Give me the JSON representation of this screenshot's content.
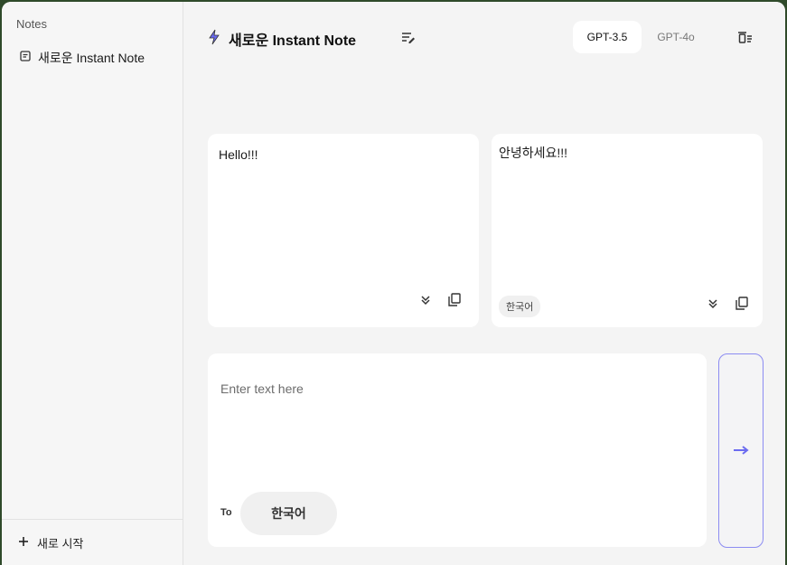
{
  "sidebar": {
    "title": "Notes",
    "notes": [
      {
        "label": "새로운 Instant Note"
      }
    ],
    "new_start_label": "새로 시작"
  },
  "header": {
    "title": "새로운 Instant Note",
    "models": [
      "GPT-3.5",
      "GPT-4o"
    ],
    "active_model": "GPT-3.5"
  },
  "source_card": {
    "text": "Hello!!!"
  },
  "result_card": {
    "text": "안녕하세요!!!",
    "language": "한국어"
  },
  "input": {
    "placeholder": "Enter text here",
    "to_label": "To",
    "target_language": "한국어"
  },
  "colors": {
    "accent": "#6b6bf0",
    "card": "#ffffff",
    "background": "#f4f4f4"
  }
}
